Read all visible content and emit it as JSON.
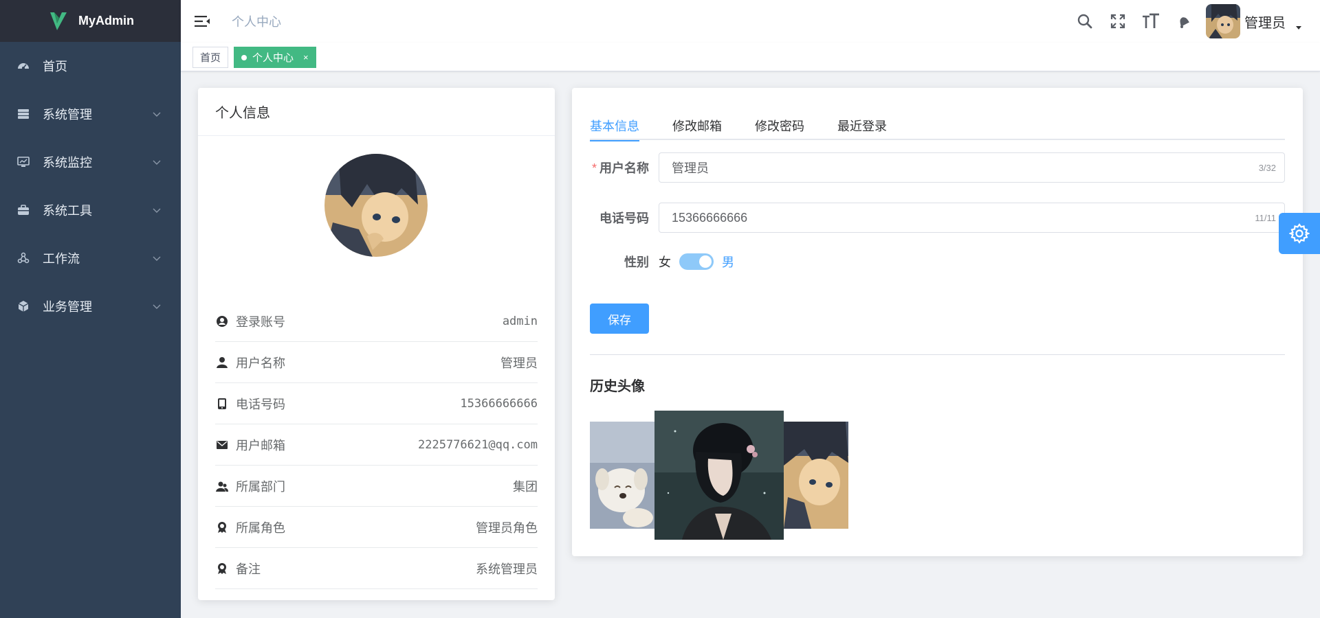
{
  "app": {
    "title": "MyAdmin"
  },
  "sidebar": {
    "items": [
      {
        "label": "首页",
        "icon": "dashboard-icon",
        "has_children": false
      },
      {
        "label": "系统管理",
        "icon": "system-icon",
        "has_children": true
      },
      {
        "label": "系统监控",
        "icon": "monitor-icon",
        "has_children": true
      },
      {
        "label": "系统工具",
        "icon": "toolbox-icon",
        "has_children": true
      },
      {
        "label": "工作流",
        "icon": "workflow-icon",
        "has_children": true
      },
      {
        "label": "业务管理",
        "icon": "business-icon",
        "has_children": true
      }
    ]
  },
  "header": {
    "breadcrumb": "个人中心",
    "user_name": "管理员"
  },
  "tags": [
    {
      "label": "首页",
      "active": false
    },
    {
      "label": "个人中心",
      "active": true,
      "close": "×"
    }
  ],
  "profile": {
    "title": "个人信息",
    "items": [
      {
        "label": "登录账号",
        "value": "admin",
        "icon": "user-circle-icon"
      },
      {
        "label": "用户名称",
        "value": "管理员",
        "icon": "user-icon"
      },
      {
        "label": "电话号码",
        "value": "15366666666",
        "icon": "phone-icon"
      },
      {
        "label": "用户邮箱",
        "value": "2225776621@qq.com",
        "icon": "mail-icon"
      },
      {
        "label": "所属部门",
        "value": "集团",
        "icon": "team-icon"
      },
      {
        "label": "所属角色",
        "value": "管理员角色",
        "icon": "badge-icon"
      },
      {
        "label": "备注",
        "value": "系统管理员",
        "icon": "badge-icon"
      }
    ]
  },
  "tabs": [
    {
      "label": "基本信息",
      "active": true
    },
    {
      "label": "修改邮箱",
      "active": false
    },
    {
      "label": "修改密码",
      "active": false
    },
    {
      "label": "最近登录",
      "active": false
    }
  ],
  "form": {
    "username": {
      "label": "用户名称",
      "required_mark": "*",
      "value": "管理员",
      "count": "3/32"
    },
    "phone": {
      "label": "电话号码",
      "value": "15366666666",
      "count": "11/11"
    },
    "gender": {
      "label": "性别",
      "off_label": "女",
      "on_label": "男",
      "checked": true
    },
    "save_label": "保存"
  },
  "history": {
    "title": "历史头像"
  },
  "colors": {
    "primary": "#409eff",
    "sidebar": "#304156",
    "tag_active": "#42b983"
  }
}
